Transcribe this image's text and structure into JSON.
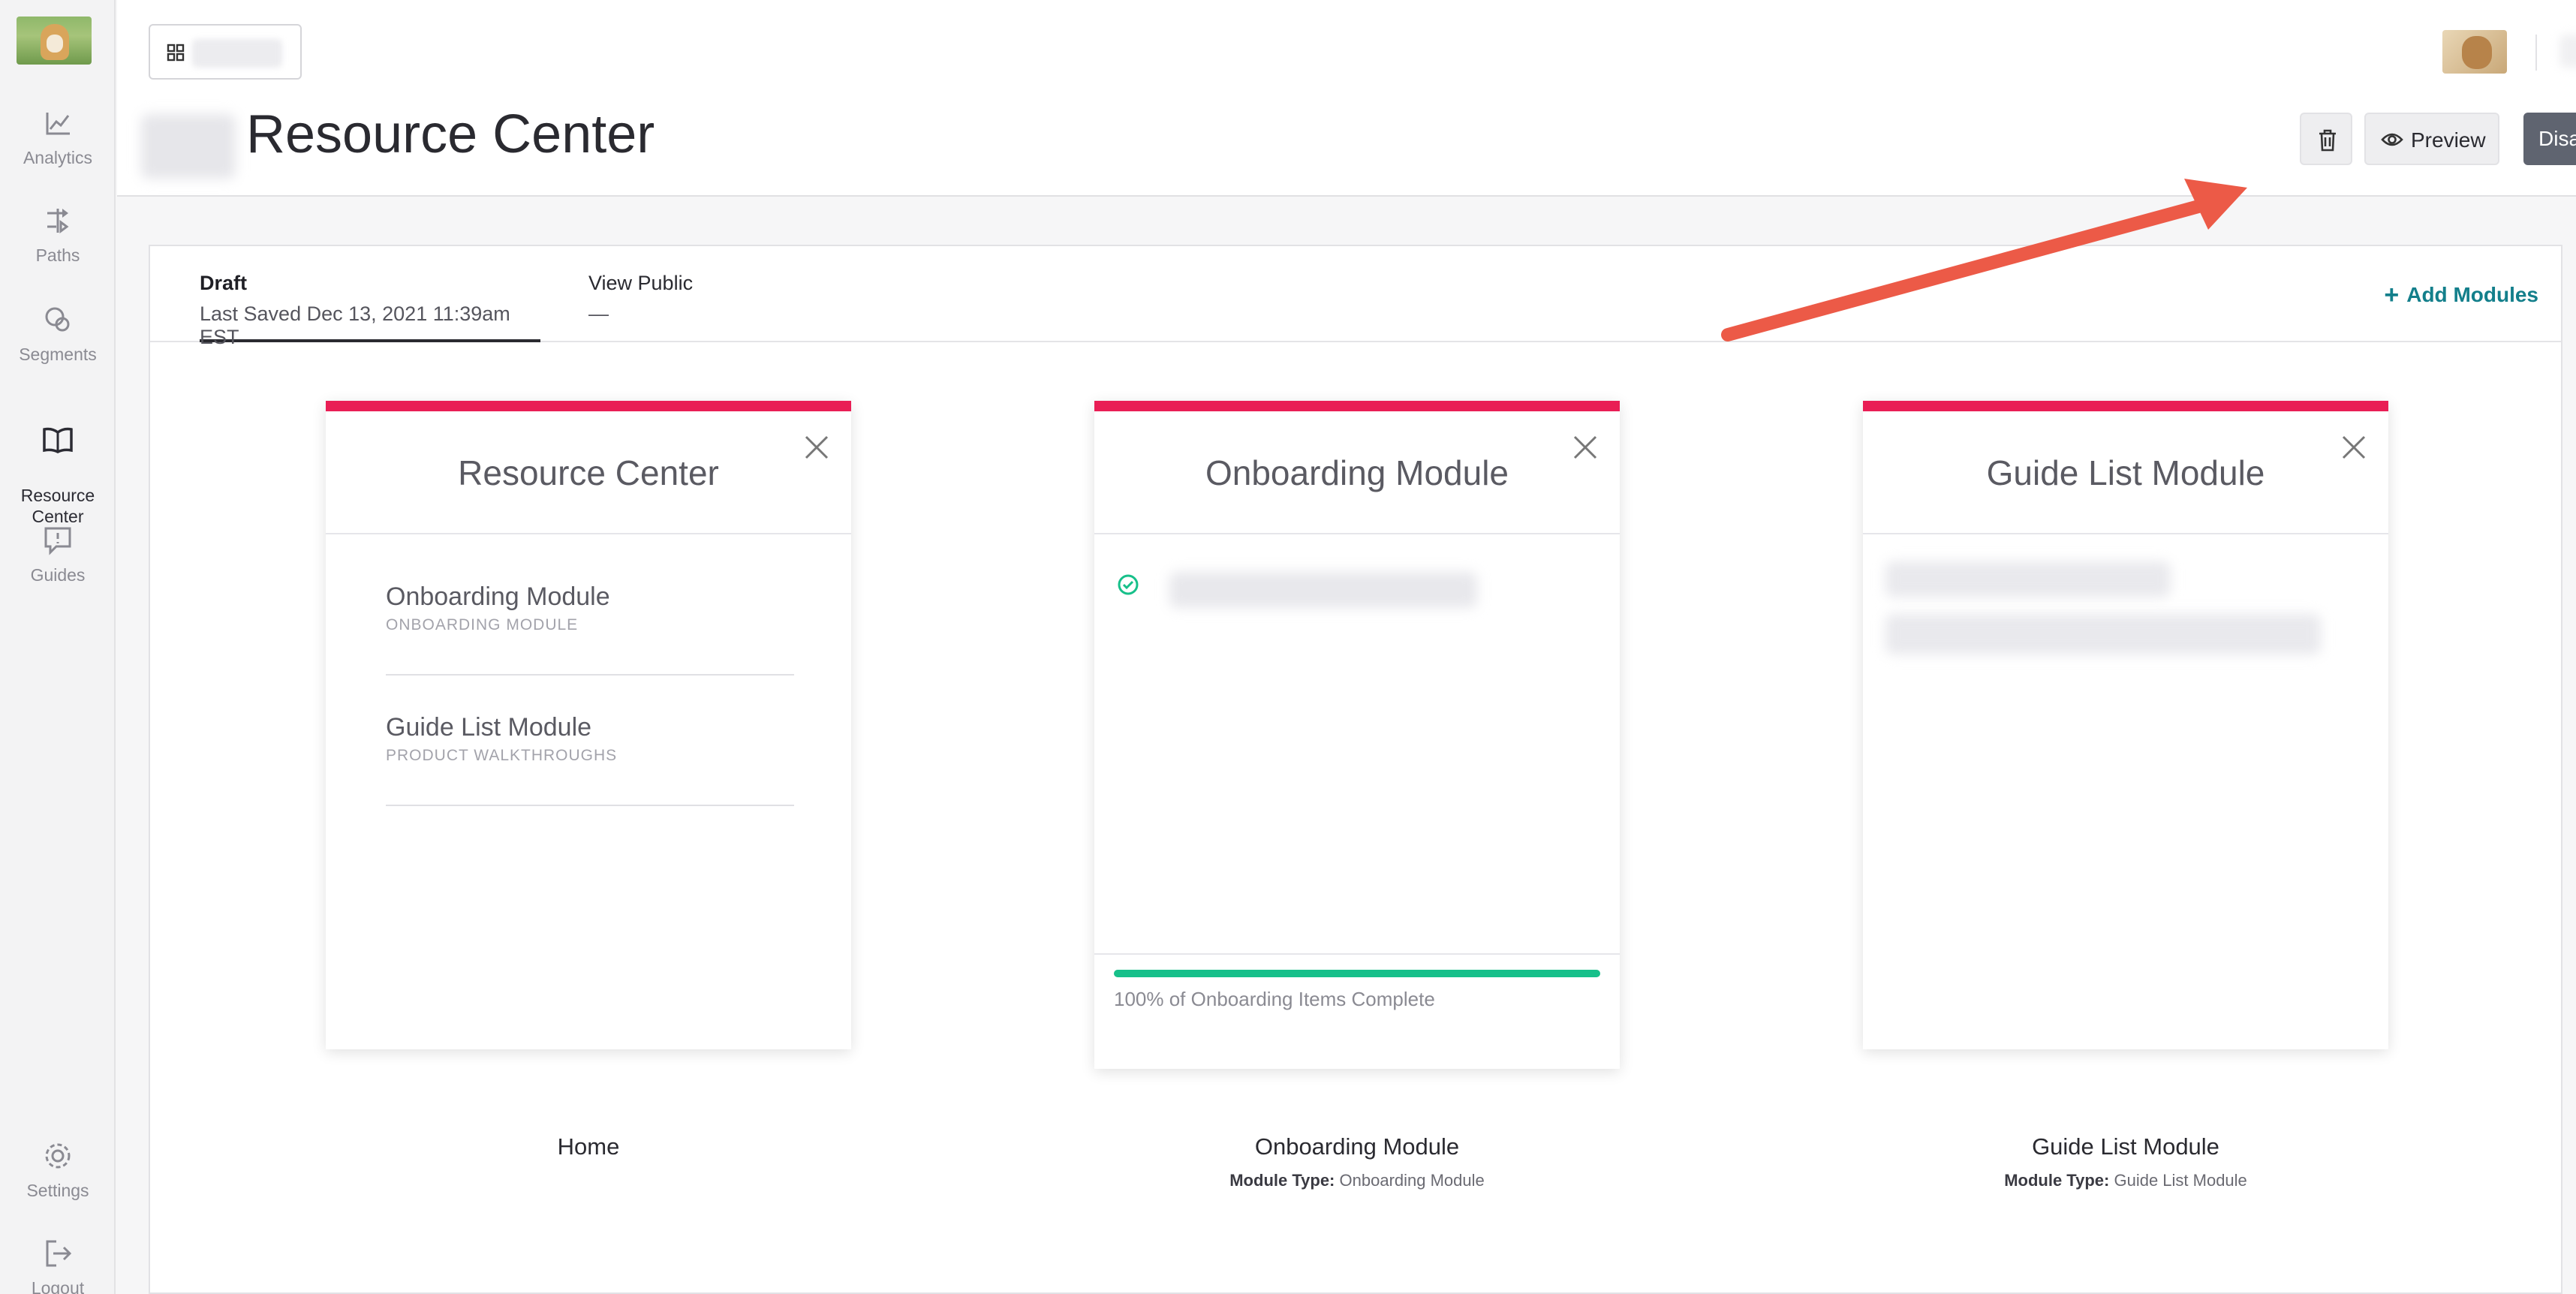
{
  "sidebar": {
    "items": [
      {
        "label": "Analytics",
        "icon": "chart-icon"
      },
      {
        "label": "Paths",
        "icon": "paths-icon"
      },
      {
        "label": "Segments",
        "icon": "segments-icon"
      },
      {
        "label": "Resource\nCenter",
        "icon": "book-icon",
        "active": true
      },
      {
        "label": "Guides",
        "icon": "guides-icon"
      },
      {
        "label": "Settings",
        "icon": "gear-icon"
      },
      {
        "label": "Logout",
        "icon": "logout-icon"
      }
    ]
  },
  "header": {
    "title": "Resource Center",
    "preview_label": "Preview",
    "status_label": "Disabled"
  },
  "tabs": [
    {
      "title": "Draft",
      "subtitle": "Last Saved Dec 13, 2021 11:39am EST"
    },
    {
      "title": "View Public",
      "subtitle": "—"
    }
  ],
  "add_modules_label": "Add Modules",
  "cards": {
    "home": {
      "title": "Resource Center",
      "items": [
        {
          "name": "Onboarding Module",
          "subtitle": "ONBOARDING MODULE"
        },
        {
          "name": "Guide List Module",
          "subtitle": "PRODUCT WALKTHROUGHS"
        }
      ]
    },
    "onboarding": {
      "title": "Onboarding Module",
      "progress": 1.0,
      "progress_label": "100% of Onboarding Items Complete"
    },
    "guide_list": {
      "title": "Guide List Module"
    }
  },
  "captions": [
    {
      "main": "Home",
      "type_label": "",
      "type_value": ""
    },
    {
      "main": "Onboarding Module",
      "type_label": "Module Type:",
      "type_value": "Onboarding Module"
    },
    {
      "main": "Guide List Module",
      "type_label": "Module Type:",
      "type_value": "Guide List Module"
    }
  ],
  "colors": {
    "accent": "#e91e55",
    "link": "#137f8b",
    "progress": "#17c08a",
    "annotation_arrow": "#ec5a47"
  }
}
